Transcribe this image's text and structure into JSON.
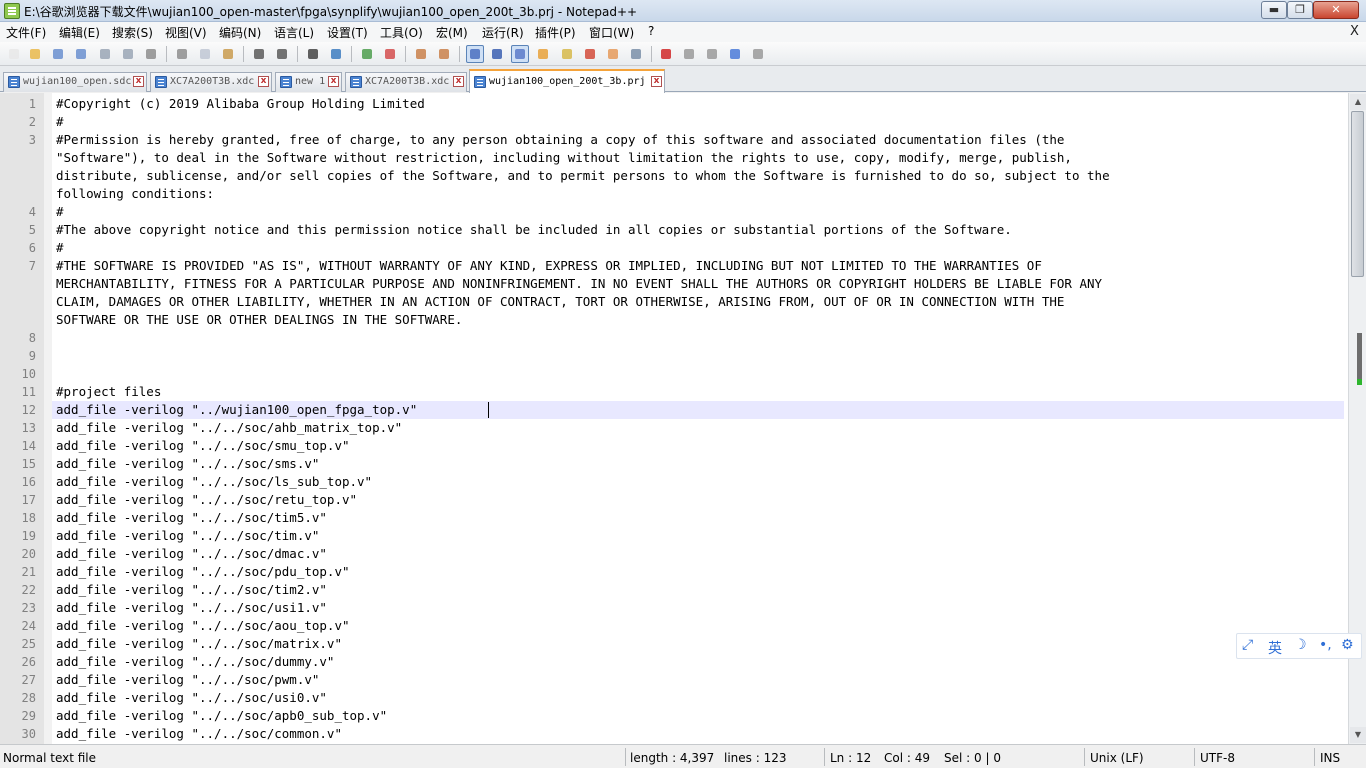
{
  "window": {
    "title": "E:\\谷歌浏览器下载文件\\wujian100_open-master\\fpga\\synplify\\wujian100_open_200t_3b.prj - Notepad++",
    "min_glyph": "▬",
    "max_glyph": "❐",
    "close_glyph": "✕"
  },
  "menu": {
    "items": [
      "文件(F)",
      "编辑(E)",
      "搜索(S)",
      "视图(V)",
      "编码(N)",
      "语言(L)",
      "设置(T)",
      "工具(O)",
      "宏(M)",
      "运行(R)",
      "插件(P)",
      "窗口(W)",
      "?"
    ],
    "close_glyph": "X"
  },
  "toolbar": {
    "buttons": [
      {
        "name": "new-file-icon",
        "color": "#e8e8e8"
      },
      {
        "name": "open-file-icon",
        "color": "#e9b84a"
      },
      {
        "name": "save-icon",
        "color": "#6a8fcf"
      },
      {
        "name": "save-all-icon",
        "color": "#6a8fcf"
      },
      {
        "name": "close-icon",
        "color": "#9aa6b5"
      },
      {
        "name": "close-all-icon",
        "color": "#9aa6b5"
      },
      {
        "name": "print-icon",
        "color": "#8d8d8d"
      },
      {
        "name": "cut-icon",
        "color": "#8e8e8e"
      },
      {
        "name": "copy-icon",
        "color": "#bfc7d3"
      },
      {
        "name": "paste-icon",
        "color": "#c99b4d"
      },
      {
        "name": "undo-icon",
        "color": "#5a5a5a"
      },
      {
        "name": "redo-icon",
        "color": "#5a5a5a"
      },
      {
        "name": "find-icon",
        "color": "#444444"
      },
      {
        "name": "replace-icon",
        "color": "#3d7dbf"
      },
      {
        "name": "zoom-in-icon",
        "color": "#4d9e4d"
      },
      {
        "name": "zoom-out-icon",
        "color": "#d34d4d"
      },
      {
        "name": "sync-vertical-icon",
        "color": "#c9804a"
      },
      {
        "name": "sync-horizontal-icon",
        "color": "#c9804a"
      },
      {
        "name": "word-wrap-icon",
        "color": "#4a6fbf"
      },
      {
        "name": "show-all-chars-icon",
        "color": "#3b5fb0"
      },
      {
        "name": "indent-guide-icon",
        "color": "#5a7ac9"
      },
      {
        "name": "user-language-icon",
        "color": "#e8a13a"
      },
      {
        "name": "doc-map-icon",
        "color": "#d6b94a"
      },
      {
        "name": "function-list-icon",
        "color": "#d24b3a"
      },
      {
        "name": "folder-workspace-icon",
        "color": "#e59a5a"
      },
      {
        "name": "monitoring-icon",
        "color": "#7a8fa8"
      },
      {
        "name": "record-macro-icon",
        "color": "#d02828"
      },
      {
        "name": "stop-macro-icon",
        "color": "#9a9a9a"
      },
      {
        "name": "play-macro-icon",
        "color": "#9a9a9a"
      },
      {
        "name": "run-macro-multiple-icon",
        "color": "#4a7ad8"
      },
      {
        "name": "save-macro-icon",
        "color": "#9a9a9a"
      }
    ]
  },
  "tabs": [
    {
      "label": "wujian100_open.sdc",
      "active": false
    },
    {
      "label": "XC7A200T3B.xdc",
      "active": false
    },
    {
      "label": "new 1",
      "active": false
    },
    {
      "label": "XC7A200T3B.xdc",
      "active": false
    },
    {
      "label": "wujian100_open_200t_3b.prj",
      "active": true
    }
  ],
  "editor": {
    "rows": [
      {
        "n": "1",
        "t": "#Copyright (c) 2019 Alibaba Group Holding Limited"
      },
      {
        "n": "2",
        "t": "#"
      },
      {
        "n": "3",
        "t": "#Permission is hereby granted, free of charge, to any person obtaining a copy of this software and associated documentation files (the"
      },
      {
        "n": "",
        "t": "\"Software\"), to deal in the Software without restriction, including without limitation the rights to use, copy, modify, merge, publish,"
      },
      {
        "n": "",
        "t": "distribute, sublicense, and/or sell copies of the Software, and to permit persons to whom the Software is furnished to do so, subject to the"
      },
      {
        "n": "",
        "t": "following conditions:"
      },
      {
        "n": "4",
        "t": "#"
      },
      {
        "n": "5",
        "t": "#The above copyright notice and this permission notice shall be included in all copies or substantial portions of the Software."
      },
      {
        "n": "6",
        "t": "#"
      },
      {
        "n": "7",
        "t": "#THE SOFTWARE IS PROVIDED \"AS IS\", WITHOUT WARRANTY OF ANY KIND, EXPRESS OR IMPLIED, INCLUDING BUT NOT LIMITED TO THE WARRANTIES OF"
      },
      {
        "n": "",
        "t": "MERCHANTABILITY, FITNESS FOR A PARTICULAR PURPOSE AND NONINFRINGEMENT. IN NO EVENT SHALL THE AUTHORS OR COPYRIGHT HOLDERS BE LIABLE FOR ANY"
      },
      {
        "n": "",
        "t": "CLAIM, DAMAGES OR OTHER LIABILITY, WHETHER IN AN ACTION OF CONTRACT, TORT OR OTHERWISE, ARISING FROM, OUT OF OR IN CONNECTION WITH THE"
      },
      {
        "n": "",
        "t": "SOFTWARE OR THE USE OR OTHER DEALINGS IN THE SOFTWARE."
      },
      {
        "n": "8",
        "t": ""
      },
      {
        "n": "9",
        "t": ""
      },
      {
        "n": "10",
        "t": ""
      },
      {
        "n": "11",
        "t": "#project files"
      },
      {
        "n": "12",
        "t": "add_file -verilog \"../wujian100_open_fpga_top.v\""
      },
      {
        "n": "13",
        "t": "add_file -verilog \"../../soc/ahb_matrix_top.v\""
      },
      {
        "n": "14",
        "t": "add_file -verilog \"../../soc/smu_top.v\""
      },
      {
        "n": "15",
        "t": "add_file -verilog \"../../soc/sms.v\""
      },
      {
        "n": "16",
        "t": "add_file -verilog \"../../soc/ls_sub_top.v\""
      },
      {
        "n": "17",
        "t": "add_file -verilog \"../../soc/retu_top.v\""
      },
      {
        "n": "18",
        "t": "add_file -verilog \"../../soc/tim5.v\""
      },
      {
        "n": "19",
        "t": "add_file -verilog \"../../soc/tim.v\""
      },
      {
        "n": "20",
        "t": "add_file -verilog \"../../soc/dmac.v\""
      },
      {
        "n": "21",
        "t": "add_file -verilog \"../../soc/pdu_top.v\""
      },
      {
        "n": "22",
        "t": "add_file -verilog \"../../soc/tim2.v\""
      },
      {
        "n": "23",
        "t": "add_file -verilog \"../../soc/usi1.v\""
      },
      {
        "n": "24",
        "t": "add_file -verilog \"../../soc/aou_top.v\""
      },
      {
        "n": "25",
        "t": "add_file -verilog \"../../soc/matrix.v\""
      },
      {
        "n": "26",
        "t": "add_file -verilog \"../../soc/dummy.v\""
      },
      {
        "n": "27",
        "t": "add_file -verilog \"../../soc/pwm.v\""
      },
      {
        "n": "28",
        "t": "add_file -verilog \"../../soc/usi0.v\""
      },
      {
        "n": "29",
        "t": "add_file -verilog \"../../soc/apb0_sub_top.v\""
      },
      {
        "n": "30",
        "t": "add_file -verilog \"../../soc/common.v\""
      }
    ]
  },
  "status": {
    "file_type": "Normal text file",
    "length": "length : 4,397",
    "lines": "lines : 123",
    "ln": "Ln : 12",
    "col": "Col : 49",
    "sel": "Sel : 0 | 0",
    "eol": "Unix (LF)",
    "encoding": "UTF-8",
    "mode": "INS"
  },
  "ime": {
    "lang": "英",
    "moon": "☽",
    "punct": "•,",
    "gear": "⚙",
    "switch": "⤢"
  }
}
